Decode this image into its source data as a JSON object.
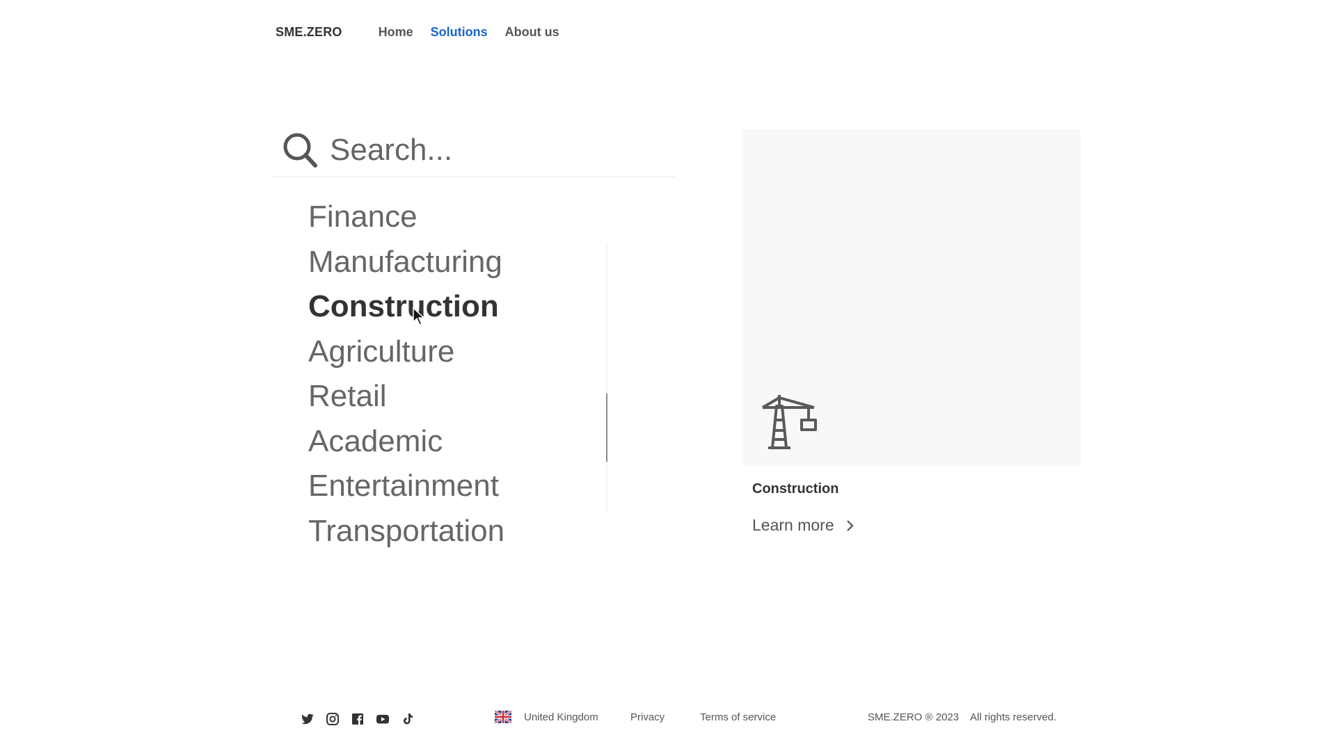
{
  "header": {
    "brand": "SME.ZERO",
    "nav": [
      {
        "label": "Home"
      },
      {
        "label": "Solutions"
      },
      {
        "label": "About us"
      }
    ]
  },
  "search": {
    "placeholder": "Search..."
  },
  "categories": {
    "items": [
      {
        "label": "Finance"
      },
      {
        "label": "Manufacturing"
      },
      {
        "label": "Construction"
      },
      {
        "label": "Agriculture"
      },
      {
        "label": "Retail"
      },
      {
        "label": "Academic"
      },
      {
        "label": "Entertainment"
      },
      {
        "label": "Transportation"
      }
    ],
    "selected": "Construction"
  },
  "card": {
    "icon": "crane-icon",
    "title": "Construction",
    "link_label": "Learn more"
  },
  "footer": {
    "socials": [
      "twitter-icon",
      "instagram-icon",
      "facebook-icon",
      "youtube-icon",
      "tiktok-icon"
    ],
    "region": "United Kingdom",
    "privacy": "Privacy",
    "terms": "Terms of service",
    "copyright": "SME.ZERO ® 2023",
    "rights": "All rights reserved."
  },
  "colors": {
    "accent": "#1a66c9",
    "text": "#555555",
    "card_bg": "#f7f8f9"
  }
}
